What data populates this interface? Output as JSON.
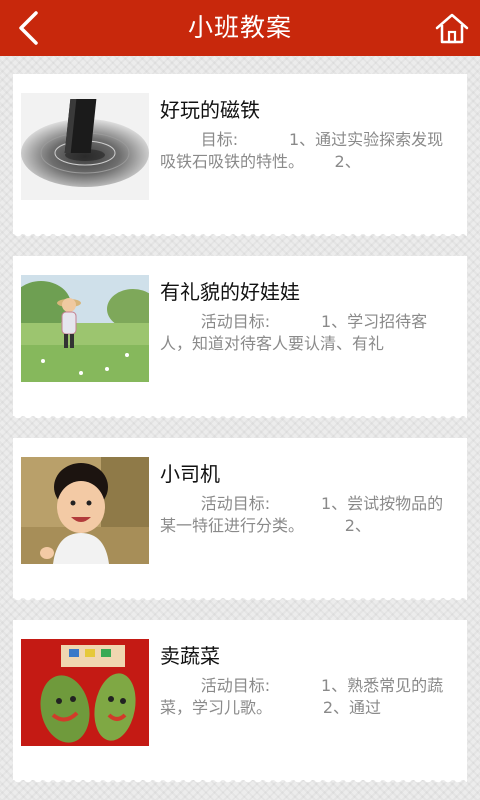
{
  "header": {
    "title": "小班教案",
    "back_icon": "chevron-left-icon",
    "home_icon": "home-icon"
  },
  "colors": {
    "header_bg": "#c8280c",
    "card_bg": "#ffffff",
    "summary_text": "#8a8a8a"
  },
  "lessons": [
    {
      "title": "好玩的磁铁",
      "summary": "        目标:          1、通过实验探索发现吸铁石吸铁的特性。      2、",
      "image": "magnet-image"
    },
    {
      "title": "有礼貌的好娃娃",
      "summary": "        活动目标:          1、学习招待客人，知道对待客人要认清、有礼",
      "image": "child-in-field-image"
    },
    {
      "title": "小司机",
      "summary": "        活动目标:          1、尝试按物品的某一特征进行分类。        2、",
      "image": "smiling-toddler-image"
    },
    {
      "title": "卖蔬菜",
      "summary": "        活动目标:          1、熟悉常见的蔬菜，学习儿歌。          2、通过",
      "image": "vegetable-faces-image"
    }
  ]
}
